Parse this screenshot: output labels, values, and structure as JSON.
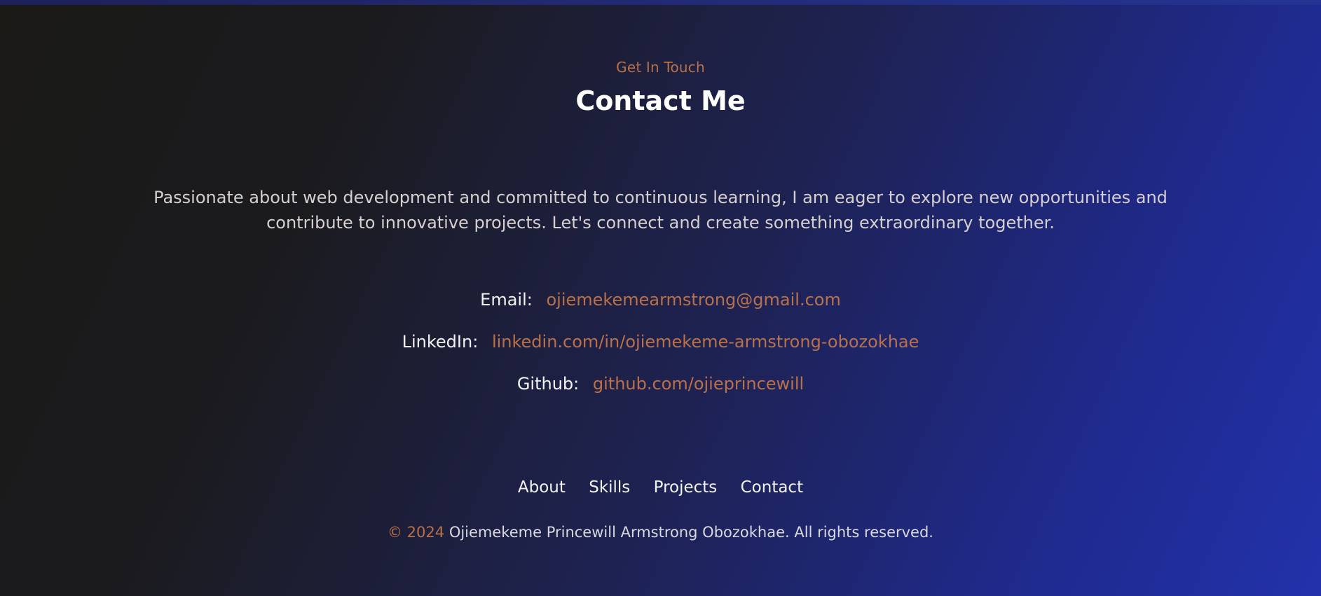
{
  "contact": {
    "eyebrow": "Get In Touch",
    "title": "Contact Me",
    "intro": "Passionate about web development and committed to continuous learning, I am eager to explore new opportunities and contribute to innovative projects. Let's connect and create something extraordinary together.",
    "email": {
      "label": "Email:",
      "value": "ojiemekemearmstrong@gmail.com"
    },
    "linkedin": {
      "label": "LinkedIn:",
      "value": "linkedin.com/in/ojiemekeme-armstrong-obozokhae"
    },
    "github": {
      "label": "Github:",
      "value": "github.com/ojieprincewill"
    }
  },
  "footer": {
    "nav": {
      "about": "About",
      "skills": "Skills",
      "projects": "Projects",
      "contact": "Contact"
    },
    "copyright_year": "© 2024",
    "copyright_text": "Ojiemekeme Princewill Armstrong Obozokhae. All rights reserved."
  },
  "colors": {
    "accent": "#b8714a",
    "text": "#ffffff",
    "muted": "#d6cfcf",
    "gradient_start": "#1a1916",
    "gradient_end": "#2232aa"
  }
}
